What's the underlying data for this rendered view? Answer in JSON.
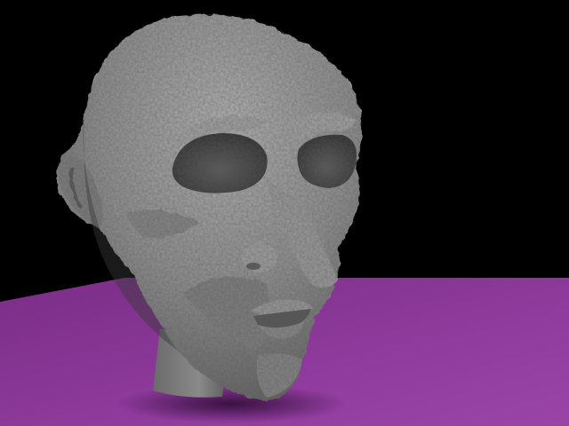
{
  "scene": {
    "background_color": "#000000",
    "floor_color": "#8e3a9c",
    "floor_shadow_color": "#3a0f42",
    "subject": "sculpted-head",
    "head_color": "#8f8f8f",
    "head_highlight_color": "#b3b3b3",
    "head_shadow_color": "#4a4a4a"
  }
}
